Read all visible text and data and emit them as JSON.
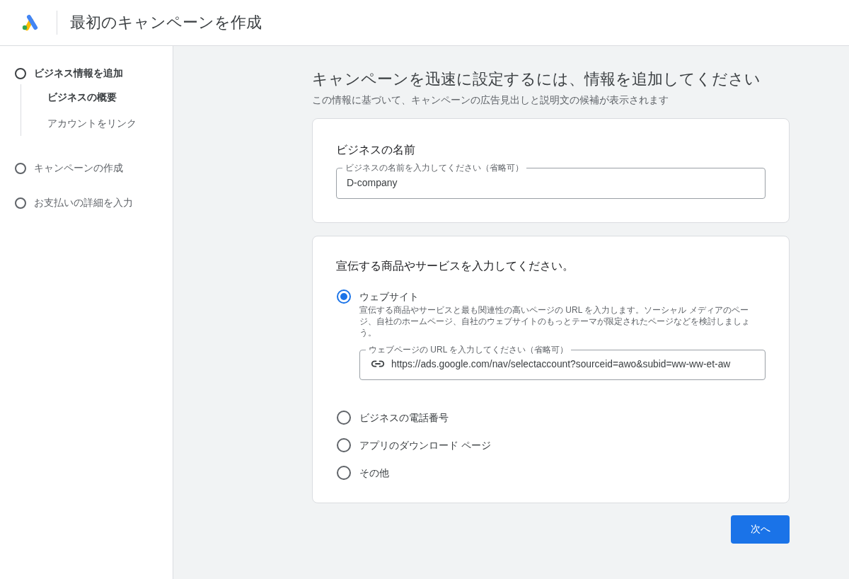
{
  "header": {
    "title": "最初のキャンペーンを作成"
  },
  "steps": [
    {
      "label": "ビジネス情報を追加",
      "selected": true,
      "children": [
        {
          "label": "ビジネスの概要",
          "selected": true
        },
        {
          "label": "アカウントをリンク",
          "selected": false
        }
      ]
    },
    {
      "label": "キャンペーンの作成",
      "selected": false
    },
    {
      "label": "お支払いの詳細を入力",
      "selected": false
    }
  ],
  "heading": "キャンペーンを迅速に設定するには、情報を追加してください",
  "subheading": "この情報に基づいて、キャンペーンの広告見出しと説明文の候補が表示されます",
  "name_card": {
    "title": "ビジネスの名前",
    "field": {
      "label": "ビジネスの名前を入力してください（省略可）",
      "value": "D-company"
    }
  },
  "offer_card": {
    "title": "宣伝する商品やサービスを入力してください。",
    "options": [
      {
        "label": "ウェブサイト",
        "selected": true,
        "description": "宣伝する商品やサービスと最も関連性の高いページの URL を入力します。ソーシャル メディアのページ、自社のホームページ、自社のウェブサイトのもっとテーマが限定されたページなどを検討しましょう。",
        "field": {
          "label": "ウェブページの URL を入力してください（省略可）",
          "value": "https://ads.google.com/nav/selectaccount?sourceid=awo&subid=ww-ww-et-aw"
        }
      },
      {
        "label": "ビジネスの電話番号",
        "selected": false
      },
      {
        "label": "アプリのダウンロード ページ",
        "selected": false
      },
      {
        "label": "その他",
        "selected": false
      }
    ]
  },
  "next_button": "次へ"
}
